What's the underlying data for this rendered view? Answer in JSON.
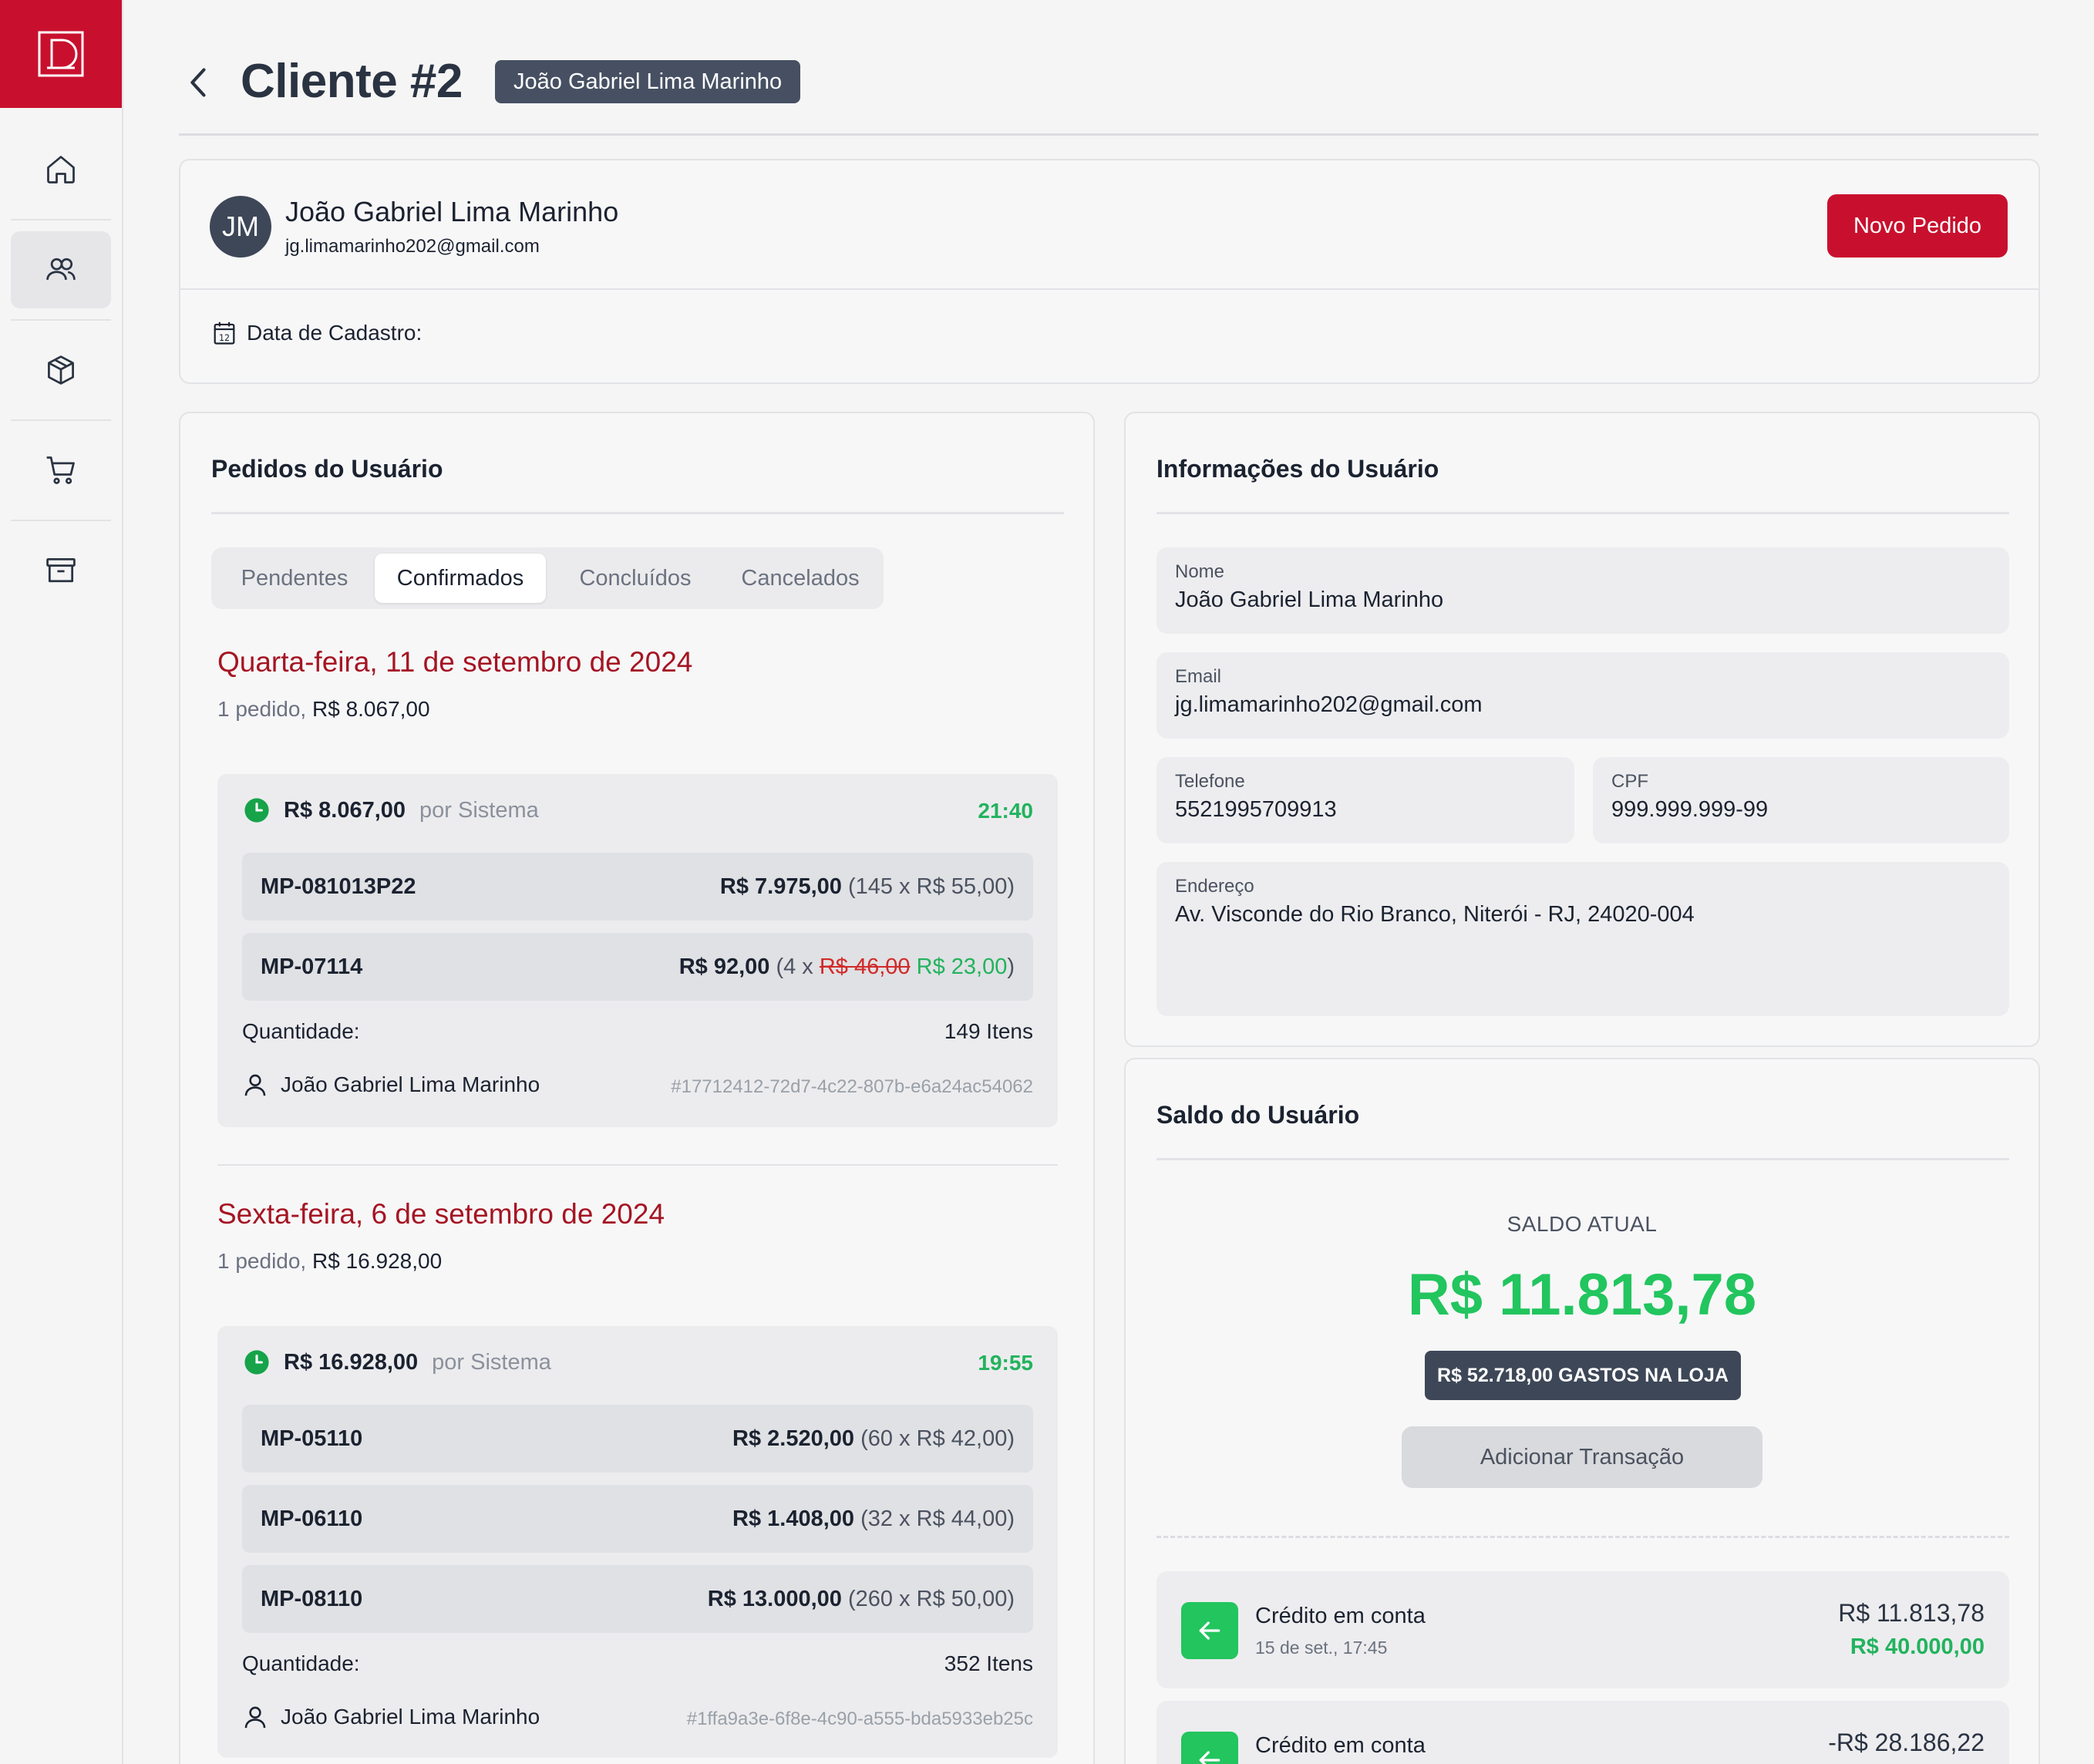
{
  "sidebar": {
    "logo": "D",
    "items": [
      {
        "icon": "home-icon"
      },
      {
        "icon": "users-icon",
        "active": true
      },
      {
        "icon": "box-icon"
      },
      {
        "icon": "cart-icon"
      },
      {
        "icon": "archive-icon"
      }
    ]
  },
  "header": {
    "title": "Cliente #2",
    "badge": "João Gabriel Lima Marinho"
  },
  "profile": {
    "initials": "JM",
    "name": "João Gabriel Lima Marinho",
    "email": "jg.limamarinho202@gmail.com",
    "new_order_label": "Novo Pedido",
    "cadastro_label": "Data de Cadastro:"
  },
  "orders": {
    "title": "Pedidos do Usuário",
    "tabs": [
      "Pendentes",
      "Confirmados",
      "Concluídos",
      "Cancelados"
    ],
    "active_tab": "Confirmados",
    "groups": [
      {
        "date": "Quarta-feira, 11 de setembro de 2024",
        "summary_prefix": "1 pedido, ",
        "summary_total": "R$ 8.067,00",
        "order": {
          "total": "R$ 8.067,00",
          "by": "por Sistema",
          "time": "21:40",
          "items": [
            {
              "code": "MP-081013P22",
              "total": "R$ 7.975,00",
              "detail": " (145 x R$ 55,00)"
            },
            {
              "code": "MP-07114",
              "total": "R$ 92,00",
              "detail_prefix": " (4 x ",
              "old_price": "R$ 46,00",
              "new_price": "R$ 23,00",
              "detail_suffix": ")"
            }
          ],
          "qty_label": "Quantidade:",
          "qty_value": "149 Itens",
          "user": "João Gabriel Lima Marinho",
          "id": "#17712412-72d7-4c22-807b-e6a24ac54062"
        }
      },
      {
        "date": "Sexta-feira, 6 de setembro de 2024",
        "summary_prefix": "1 pedido, ",
        "summary_total": "R$ 16.928,00",
        "order": {
          "total": "R$ 16.928,00",
          "by": "por Sistema",
          "time": "19:55",
          "items": [
            {
              "code": "MP-05110",
              "total": "R$ 2.520,00",
              "detail": " (60 x R$ 42,00)"
            },
            {
              "code": "MP-06110",
              "total": "R$ 1.408,00",
              "detail": " (32 x R$ 44,00)"
            },
            {
              "code": "MP-08110",
              "total": "R$ 13.000,00",
              "detail": " (260 x R$ 50,00)"
            }
          ],
          "qty_label": "Quantidade:",
          "qty_value": "352 Itens",
          "user": "João Gabriel Lima Marinho",
          "id": "#1ffa9a3e-6f8e-4c90-a555-bda5933eb25c"
        }
      }
    ]
  },
  "info": {
    "title": "Informações do Usuário",
    "nome_label": "Nome",
    "nome": "João Gabriel Lima Marinho",
    "email_label": "Email",
    "email": "jg.limamarinho202@gmail.com",
    "telefone_label": "Telefone",
    "telefone": "5521995709913",
    "cpf_label": "CPF",
    "cpf": "999.999.999-99",
    "endereco_label": "Endereço",
    "endereco": "Av. Visconde do Rio Branco, Niterói - RJ, 24020-004"
  },
  "balance": {
    "title": "Saldo do Usuário",
    "label": "SALDO ATUAL",
    "value": "R$ 11.813,78",
    "spent": "R$ 52.718,00 GASTOS NA LOJA",
    "add_label": "Adicionar Transação",
    "transactions": [
      {
        "title": "Crédito em conta",
        "date": "15 de set., 17:45",
        "amount": "R$ 11.813,78",
        "balance": "R$ 40.000,00"
      },
      {
        "title": "Crédito em conta",
        "date": "",
        "amount": "-R$ 28.186,22",
        "balance": ""
      }
    ]
  },
  "colors": {
    "brand_red": "#c8102e",
    "date_red": "#a51523",
    "success_green": "#22c55e",
    "badge_dark": "#465062"
  }
}
